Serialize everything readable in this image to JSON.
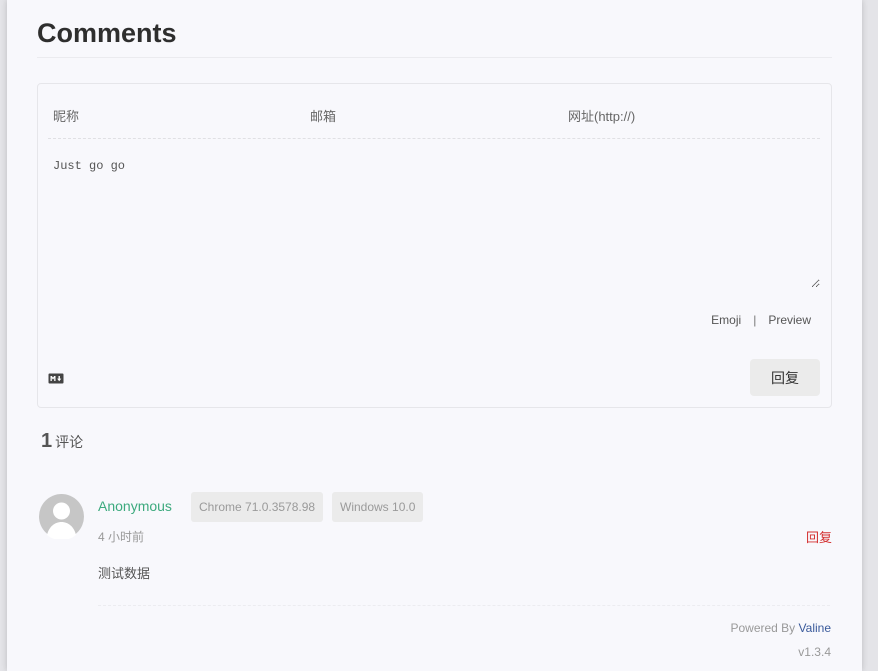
{
  "section": {
    "title": "Comments"
  },
  "form": {
    "nick_placeholder": "昵称",
    "mail_placeholder": "邮箱",
    "link_placeholder": "网址(http://)",
    "editor_value": "Just go go",
    "emoji_label": "Emoji",
    "separator": "|",
    "preview_label": "Preview",
    "submit_label": "回复"
  },
  "count": {
    "number": "1",
    "label": "评论"
  },
  "comments": [
    {
      "nick": "Anonymous",
      "browser": "Chrome 71.0.3578.98",
      "os": "Windows 10.0",
      "time": "4 小时前",
      "reply_label": "回复",
      "content": "测试数据"
    }
  ],
  "footer": {
    "powered_prefix": "Powered By",
    "powered_name": "Valine",
    "version": "v1.3.4"
  },
  "colors": {
    "nick": "#3daa7e",
    "reply": "#d32f2f",
    "valine_link": "#3a5a9b"
  },
  "icons": {
    "markdown": "markdown-icon",
    "avatar": "default-avatar-icon"
  }
}
